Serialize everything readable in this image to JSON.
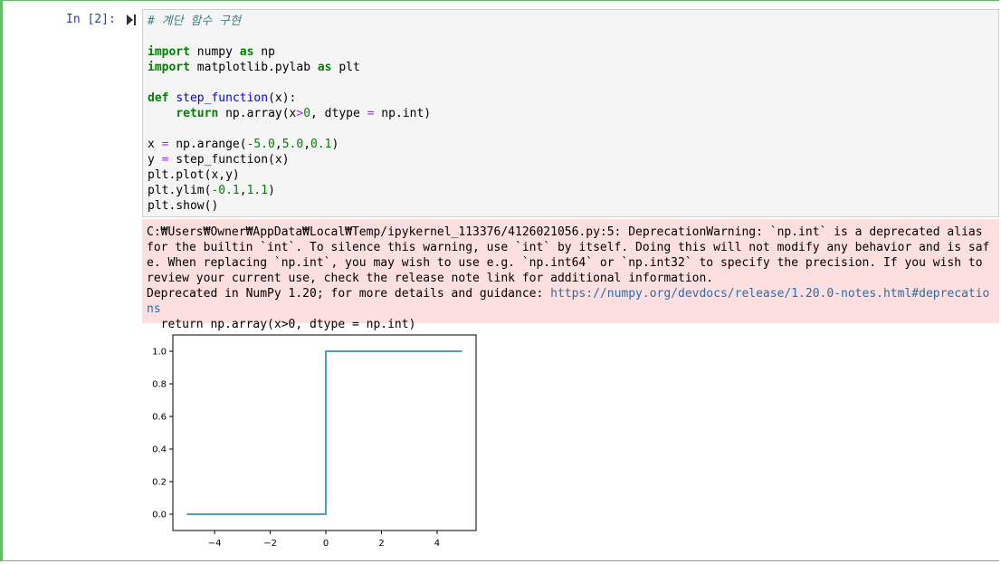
{
  "cell": {
    "prompt": "In [2]:",
    "code": {
      "comment": "# 계단 함수 구현",
      "lines": {
        "l2_kw1": "import",
        "l2_mod": " numpy ",
        "l2_kw2": "as",
        "l2_alias": " np",
        "l3_kw1": "import",
        "l3_mod": " matplotlib.pylab ",
        "l3_kw2": "as",
        "l3_alias": " plt",
        "l5_kw": "def",
        "l5_fn": "step_function",
        "l5_rest": "(x):",
        "l6_kw": "return",
        "l6_a": " np.array(x",
        "l6_op1": ">",
        "l6_n": "0",
        "l6_b": ", dtype ",
        "l6_op2": "=",
        "l6_c": " np.int)",
        "l8_a": "x ",
        "l8_op": "=",
        "l8_b": " np.arange(",
        "l8_n1": "-5.0",
        "l8_c1": ",",
        "l8_n2": "5.0",
        "l8_c2": ",",
        "l8_n3": "0.1",
        "l8_d": ")",
        "l9_a": "y ",
        "l9_op": "=",
        "l9_b": " step_function(x)",
        "l10": "plt.plot(x,y)",
        "l11_a": "plt.ylim(",
        "l11_n1": "-0.1",
        "l11_c": ",",
        "l11_n2": "1.1",
        "l11_d": ")",
        "l12": "plt.show()"
      }
    },
    "stderr": {
      "text": "C:₩Users₩Owner₩AppData₩Local₩Temp/ipykernel_113376/4126021056.py:5: DeprecationWarning: `np.int` is a deprecated alias for the builtin `int`. To silence this warning, use `int` by itself. Doing this will not modify any behavior and is safe. When replacing `np.int`, you may wish to use e.g. `np.int64` or `np.int32` to specify the precision. If you wish to review your current use, check the release note link for additional information.",
      "deprecated_prefix": "Deprecated in NumPy 1.20; for more details and guidance: ",
      "link": "https://numpy.org/devdocs/release/1.20.0-notes.html#deprecations",
      "return_line": "  return np.array(x>0, dtype = np.int)"
    }
  },
  "chart_data": {
    "type": "line",
    "x": [
      -5.0,
      0.0,
      0.0,
      4.9
    ],
    "y": [
      0,
      0,
      1,
      1
    ],
    "xlim": [
      -5.5,
      5.4
    ],
    "ylim": [
      -0.1,
      1.1
    ],
    "xticks": [
      -4,
      -2,
      0,
      2,
      4
    ],
    "xtick_labels": [
      "−4",
      "−2",
      "0",
      "2",
      "4"
    ],
    "yticks": [
      0.0,
      0.2,
      0.4,
      0.6,
      0.8,
      1.0
    ],
    "ytick_labels": [
      "0.0",
      "0.2",
      "0.4",
      "0.6",
      "0.8",
      "1.0"
    ],
    "line_color": "#1f77b4",
    "grid": false,
    "title": "",
    "xlabel": "",
    "ylabel": ""
  }
}
